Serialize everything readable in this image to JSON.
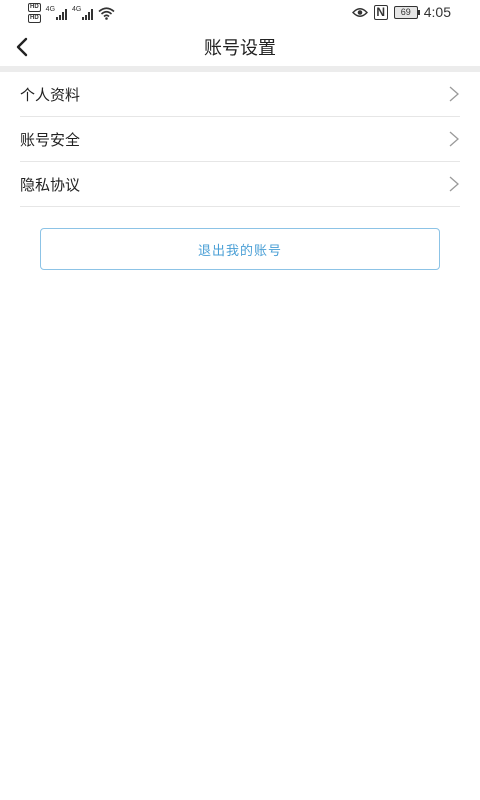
{
  "status_bar": {
    "hd_label": "HD",
    "network_1": "4G",
    "network_2": "4G",
    "battery": "69",
    "nfc": "N",
    "time": "4:05"
  },
  "header": {
    "title": "账号设置",
    "back_icon": "chevron-left-icon"
  },
  "menu": {
    "items": [
      {
        "label": "个人资料",
        "icon": "chevron-right-icon"
      },
      {
        "label": "账号安全",
        "icon": "chevron-right-icon"
      },
      {
        "label": "隐私协议",
        "icon": "chevron-right-icon"
      }
    ]
  },
  "logout": {
    "label": "退出我的账号"
  },
  "colors": {
    "accent": "#4a9fd6",
    "accent_border": "#8cc3e6",
    "divider": "#e6e6e6",
    "section_gap": "#ececec"
  }
}
